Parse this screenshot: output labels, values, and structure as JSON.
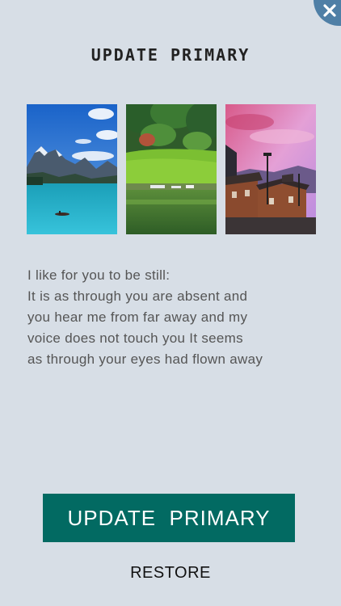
{
  "header": {
    "title": "UPDATE PRIMARY"
  },
  "icons": {
    "close": "close-icon"
  },
  "colors": {
    "background": "#d7dee6",
    "accent_button": "#026a62",
    "close_badge": "#4f7fa6"
  },
  "thumbnails": [
    {
      "icon": "mountain-lake-image"
    },
    {
      "icon": "green-field-lake-image"
    },
    {
      "icon": "sunset-houses-image"
    }
  ],
  "poem": {
    "lines": [
      "I like for you to be still:",
      "It is as through you are absent and",
      "you hear me from far away and my",
      "voice does not touch you It seems",
      "as through your eyes had flown away"
    ]
  },
  "actions": {
    "primary_label": "UPDATE  PRIMARY",
    "restore_label": "RESTORE"
  }
}
